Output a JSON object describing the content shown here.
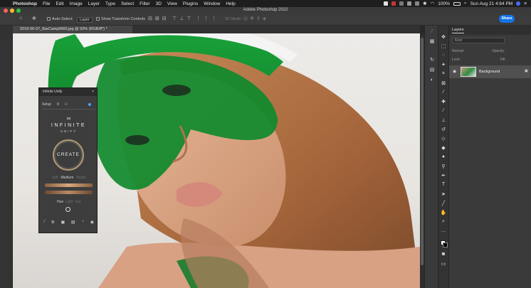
{
  "menubar": {
    "apple": "",
    "app_name": "Photoshop",
    "items": [
      "File",
      "Edit",
      "Image",
      "Layer",
      "Type",
      "Select",
      "Filter",
      "3D",
      "View",
      "Plugins",
      "Window",
      "Help"
    ],
    "battery": "100%",
    "clock": "Sun Aug 21  4:64 PM"
  },
  "window": {
    "title": "Adobe Photoshop 2022"
  },
  "options_bar": {
    "home_icon": "⌂",
    "move_icon": "✥",
    "auto_select_label": "Auto-Select:",
    "auto_select_value": "Layer",
    "transform_label": "Show Transform Controls",
    "mode_3d_label": "3D Mode:",
    "share_label": "Share"
  },
  "document": {
    "tab_label": "2018-06-07_BarCamp0666.jpg @ 50% (RGB/8*) *"
  },
  "unify_panel": {
    "title": "Infinite Unify",
    "close": "×",
    "tab_setup": "Setup",
    "logo_glyph": "∞",
    "brand_line1": "INFINITE",
    "brand_line2": "UNIFY",
    "create_label": "CREATE",
    "strength_low": "Soft",
    "strength_mid": "Medium",
    "strength_high": "Bright",
    "hue_label": "Hue",
    "light_label": "Light",
    "sat_label": "Sat"
  },
  "layers_panel": {
    "title": "Layers",
    "kind_placeholder": "Kind",
    "blend_mode": "Normal",
    "opacity_label": "Opacity:",
    "lock_label": "Lock:",
    "fill_label": "Fill:",
    "layer_name": "Background"
  },
  "colors": {
    "accent_blue": "#1473e6",
    "panel_bg": "#3a3a3a",
    "overlay_green": "#0f8a2c"
  }
}
